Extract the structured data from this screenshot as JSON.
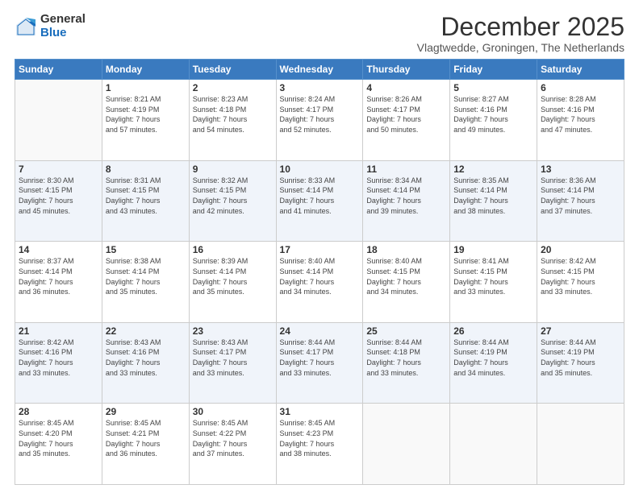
{
  "logo": {
    "general": "General",
    "blue": "Blue"
  },
  "header": {
    "month": "December 2025",
    "location": "Vlagtwedde, Groningen, The Netherlands"
  },
  "weekdays": [
    "Sunday",
    "Monday",
    "Tuesday",
    "Wednesday",
    "Thursday",
    "Friday",
    "Saturday"
  ],
  "weeks": [
    [
      {
        "day": "",
        "info": ""
      },
      {
        "day": "1",
        "info": "Sunrise: 8:21 AM\nSunset: 4:19 PM\nDaylight: 7 hours\nand 57 minutes."
      },
      {
        "day": "2",
        "info": "Sunrise: 8:23 AM\nSunset: 4:18 PM\nDaylight: 7 hours\nand 54 minutes."
      },
      {
        "day": "3",
        "info": "Sunrise: 8:24 AM\nSunset: 4:17 PM\nDaylight: 7 hours\nand 52 minutes."
      },
      {
        "day": "4",
        "info": "Sunrise: 8:26 AM\nSunset: 4:17 PM\nDaylight: 7 hours\nand 50 minutes."
      },
      {
        "day": "5",
        "info": "Sunrise: 8:27 AM\nSunset: 4:16 PM\nDaylight: 7 hours\nand 49 minutes."
      },
      {
        "day": "6",
        "info": "Sunrise: 8:28 AM\nSunset: 4:16 PM\nDaylight: 7 hours\nand 47 minutes."
      }
    ],
    [
      {
        "day": "7",
        "info": "Sunrise: 8:30 AM\nSunset: 4:15 PM\nDaylight: 7 hours\nand 45 minutes."
      },
      {
        "day": "8",
        "info": "Sunrise: 8:31 AM\nSunset: 4:15 PM\nDaylight: 7 hours\nand 43 minutes."
      },
      {
        "day": "9",
        "info": "Sunrise: 8:32 AM\nSunset: 4:15 PM\nDaylight: 7 hours\nand 42 minutes."
      },
      {
        "day": "10",
        "info": "Sunrise: 8:33 AM\nSunset: 4:14 PM\nDaylight: 7 hours\nand 41 minutes."
      },
      {
        "day": "11",
        "info": "Sunrise: 8:34 AM\nSunset: 4:14 PM\nDaylight: 7 hours\nand 39 minutes."
      },
      {
        "day": "12",
        "info": "Sunrise: 8:35 AM\nSunset: 4:14 PM\nDaylight: 7 hours\nand 38 minutes."
      },
      {
        "day": "13",
        "info": "Sunrise: 8:36 AM\nSunset: 4:14 PM\nDaylight: 7 hours\nand 37 minutes."
      }
    ],
    [
      {
        "day": "14",
        "info": "Sunrise: 8:37 AM\nSunset: 4:14 PM\nDaylight: 7 hours\nand 36 minutes."
      },
      {
        "day": "15",
        "info": "Sunrise: 8:38 AM\nSunset: 4:14 PM\nDaylight: 7 hours\nand 35 minutes."
      },
      {
        "day": "16",
        "info": "Sunrise: 8:39 AM\nSunset: 4:14 PM\nDaylight: 7 hours\nand 35 minutes."
      },
      {
        "day": "17",
        "info": "Sunrise: 8:40 AM\nSunset: 4:14 PM\nDaylight: 7 hours\nand 34 minutes."
      },
      {
        "day": "18",
        "info": "Sunrise: 8:40 AM\nSunset: 4:15 PM\nDaylight: 7 hours\nand 34 minutes."
      },
      {
        "day": "19",
        "info": "Sunrise: 8:41 AM\nSunset: 4:15 PM\nDaylight: 7 hours\nand 33 minutes."
      },
      {
        "day": "20",
        "info": "Sunrise: 8:42 AM\nSunset: 4:15 PM\nDaylight: 7 hours\nand 33 minutes."
      }
    ],
    [
      {
        "day": "21",
        "info": "Sunrise: 8:42 AM\nSunset: 4:16 PM\nDaylight: 7 hours\nand 33 minutes."
      },
      {
        "day": "22",
        "info": "Sunrise: 8:43 AM\nSunset: 4:16 PM\nDaylight: 7 hours\nand 33 minutes."
      },
      {
        "day": "23",
        "info": "Sunrise: 8:43 AM\nSunset: 4:17 PM\nDaylight: 7 hours\nand 33 minutes."
      },
      {
        "day": "24",
        "info": "Sunrise: 8:44 AM\nSunset: 4:17 PM\nDaylight: 7 hours\nand 33 minutes."
      },
      {
        "day": "25",
        "info": "Sunrise: 8:44 AM\nSunset: 4:18 PM\nDaylight: 7 hours\nand 33 minutes."
      },
      {
        "day": "26",
        "info": "Sunrise: 8:44 AM\nSunset: 4:19 PM\nDaylight: 7 hours\nand 34 minutes."
      },
      {
        "day": "27",
        "info": "Sunrise: 8:44 AM\nSunset: 4:19 PM\nDaylight: 7 hours\nand 35 minutes."
      }
    ],
    [
      {
        "day": "28",
        "info": "Sunrise: 8:45 AM\nSunset: 4:20 PM\nDaylight: 7 hours\nand 35 minutes."
      },
      {
        "day": "29",
        "info": "Sunrise: 8:45 AM\nSunset: 4:21 PM\nDaylight: 7 hours\nand 36 minutes."
      },
      {
        "day": "30",
        "info": "Sunrise: 8:45 AM\nSunset: 4:22 PM\nDaylight: 7 hours\nand 37 minutes."
      },
      {
        "day": "31",
        "info": "Sunrise: 8:45 AM\nSunset: 4:23 PM\nDaylight: 7 hours\nand 38 minutes."
      },
      {
        "day": "",
        "info": ""
      },
      {
        "day": "",
        "info": ""
      },
      {
        "day": "",
        "info": ""
      }
    ]
  ]
}
